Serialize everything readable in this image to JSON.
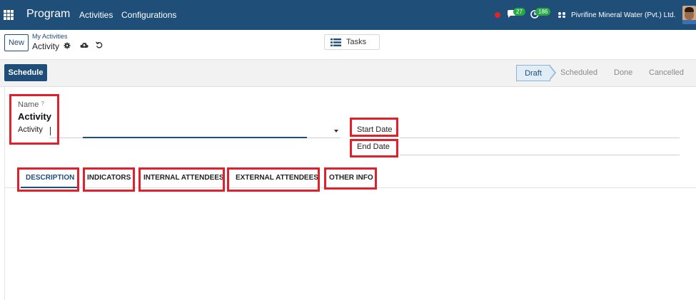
{
  "nav": {
    "app_name": "Program",
    "menu": [
      "Activities",
      "Configurations"
    ],
    "chat_count": "27",
    "activity_count": "186",
    "company": "Pivrifine Mineral Water (Pvt.) Ltd."
  },
  "control": {
    "new_label": "New",
    "breadcrumb": "My Activities",
    "record_title": "Activity",
    "tasks_label": "Tasks"
  },
  "statusbar": {
    "schedule_label": "Schedule",
    "stages": [
      "Draft",
      "Scheduled",
      "Done",
      "Cancelled"
    ],
    "active_stage": "Draft"
  },
  "form": {
    "name_label": "Name",
    "name_tooltip": "?",
    "name_value": "Activity",
    "activity_label": "Activity",
    "start_date_label": "Start Date",
    "end_date_label": "End Date"
  },
  "tabs": [
    "DESCRIPTION",
    "INDICATORS",
    "INTERNAL ATTENDEES",
    "EXTERNAL ATTENDEES",
    "OTHER INFO"
  ],
  "colors": {
    "nav_bg": "#1f4e79",
    "highlight": "#e0212b",
    "badge": "#28a745"
  }
}
